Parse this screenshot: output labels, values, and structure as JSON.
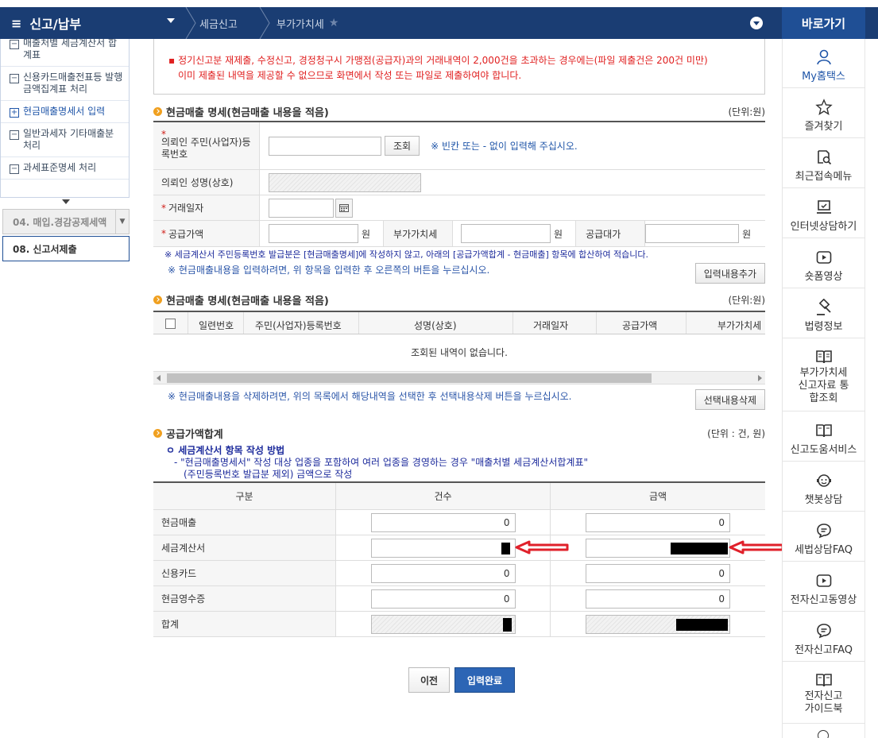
{
  "topbar": {
    "menu_title": "신고/납부",
    "crumbs": [
      "세금신고",
      "부가가치세"
    ],
    "goto_label": "바로가기"
  },
  "sidebar": {
    "items": [
      {
        "label": "매출처별 세금계산서 합계표",
        "marker": "−"
      },
      {
        "label": "신용카드매출전표등 발행금액집계표 처리",
        "marker": "−"
      },
      {
        "label": "현금매출명세서 입력",
        "marker": "+"
      },
      {
        "label": "일반과세자 기타매출분 처리",
        "marker": "−"
      },
      {
        "label": "과세표준명세 처리",
        "marker": "−"
      }
    ],
    "step4": "04. 매입.경감공제세액",
    "step8": "08. 신고서제출"
  },
  "notice": {
    "line1": "정기신고분 재제출, 수정신고, 경정청구시 가맹점(공급자)과의 거래내역이 2,000건을 초과하는 경우에는(파일 제출건은 200건 미만)",
    "line2": "이미 제출된 내역을 제공할 수 없으므로 화면에서 작성 또는 파일로 제출하여야 합니다."
  },
  "section1": {
    "title": "현금매출 명세(현금매출 내용을 적음)",
    "unit": "(단위:원)",
    "id_label": "의뢰인 주민(사업자)등록번호",
    "lookup_button": "조회",
    "id_hint": "※ 빈칸 또는 - 없이 입력해 주십시오.",
    "name_label": "의뢰인 성명(상호)",
    "date_label": "거래일자",
    "supply_label": "공급가액",
    "won": "원",
    "vat_label": "부가가치세",
    "total_label": "공급대가",
    "note1": "※ 세금계산서 주민등록번호 발급분은 [현금매출명세]에 작성하지 않고, 아래의 [공급가액합계 - 현금매출] 항목에 합산하여 적습니다.",
    "note2": "※ 현금매출내용을 입력하려면, 위 항목을 입력한 후 오른쪽의 버튼을 누르십시오.",
    "add_button": "입력내용추가"
  },
  "section2": {
    "title": "현금매출 명세(현금매출 내용을 적음)",
    "unit": "(단위:원)",
    "columns": [
      "일련번호",
      "주민(사업자)등록번호",
      "성명(상호)",
      "거래일자",
      "공급가액",
      "부가가치세"
    ],
    "empty": "조회된 내역이 없습니다.",
    "delete_note": "※ 현금매출내용을 삭제하려면, 위의 목록에서 해당내역을 선택한 후 선택내용삭제 버튼을 누르십시오.",
    "delete_button": "선택내용삭제"
  },
  "section3": {
    "title": "공급가액합계",
    "unit": "(단위 : 건, 원)",
    "method_title": "ㅇ 세금계산서 항목 작성 방법",
    "method_line1": "- \"현금매출명세서\" 작성 대상 업종을 포함하여 여러 업종을 경영하는 경우 \"매출처별 세금계산서합계표\"",
    "method_line2": "(주민등록번호 발급분 제외) 금액으로 작성",
    "headers": [
      "구분",
      "건수",
      "금액"
    ],
    "rows": [
      {
        "label": "현금매출",
        "count": "0",
        "amount": "0"
      },
      {
        "label": "세금계산서",
        "count": "",
        "amount": ""
      },
      {
        "label": "신용카드",
        "count": "0",
        "amount": "0"
      },
      {
        "label": "현금영수증",
        "count": "0",
        "amount": "0"
      },
      {
        "label": "합계",
        "count": "",
        "amount": ""
      }
    ]
  },
  "buttons": {
    "prev": "이전",
    "done": "입력완료"
  },
  "quick_menu": [
    {
      "label": "My홈택스",
      "icon": "person-icon"
    },
    {
      "label": "즐겨찾기",
      "icon": "star-icon"
    },
    {
      "label": "최근접속메뉴",
      "icon": "recent-icon"
    },
    {
      "label": "인터넷상담하기",
      "icon": "pc-check-icon"
    },
    {
      "label": "숏폼영상",
      "icon": "play-icon"
    },
    {
      "label": "법령정보",
      "icon": "gavel-icon"
    },
    {
      "label": "부가가치세 신고자료 통합조회",
      "icon": "book-icon"
    },
    {
      "label": "신고도움서비스",
      "icon": "book-icon"
    },
    {
      "label": "챗봇상담",
      "icon": "chatbot-icon"
    },
    {
      "label": "세법상담FAQ",
      "icon": "chat-icon"
    },
    {
      "label": "전자신고동영상",
      "icon": "play-icon"
    },
    {
      "label": "전자신고FAQ",
      "icon": "chat-icon"
    },
    {
      "label": "전자신고 가이드북",
      "icon": "book-icon"
    }
  ],
  "colors": {
    "nav": "#1a3d73",
    "goto": "#1f4f95",
    "accent": "#f0a020",
    "notice": "#e02020",
    "arrow": "#e0202a"
  }
}
